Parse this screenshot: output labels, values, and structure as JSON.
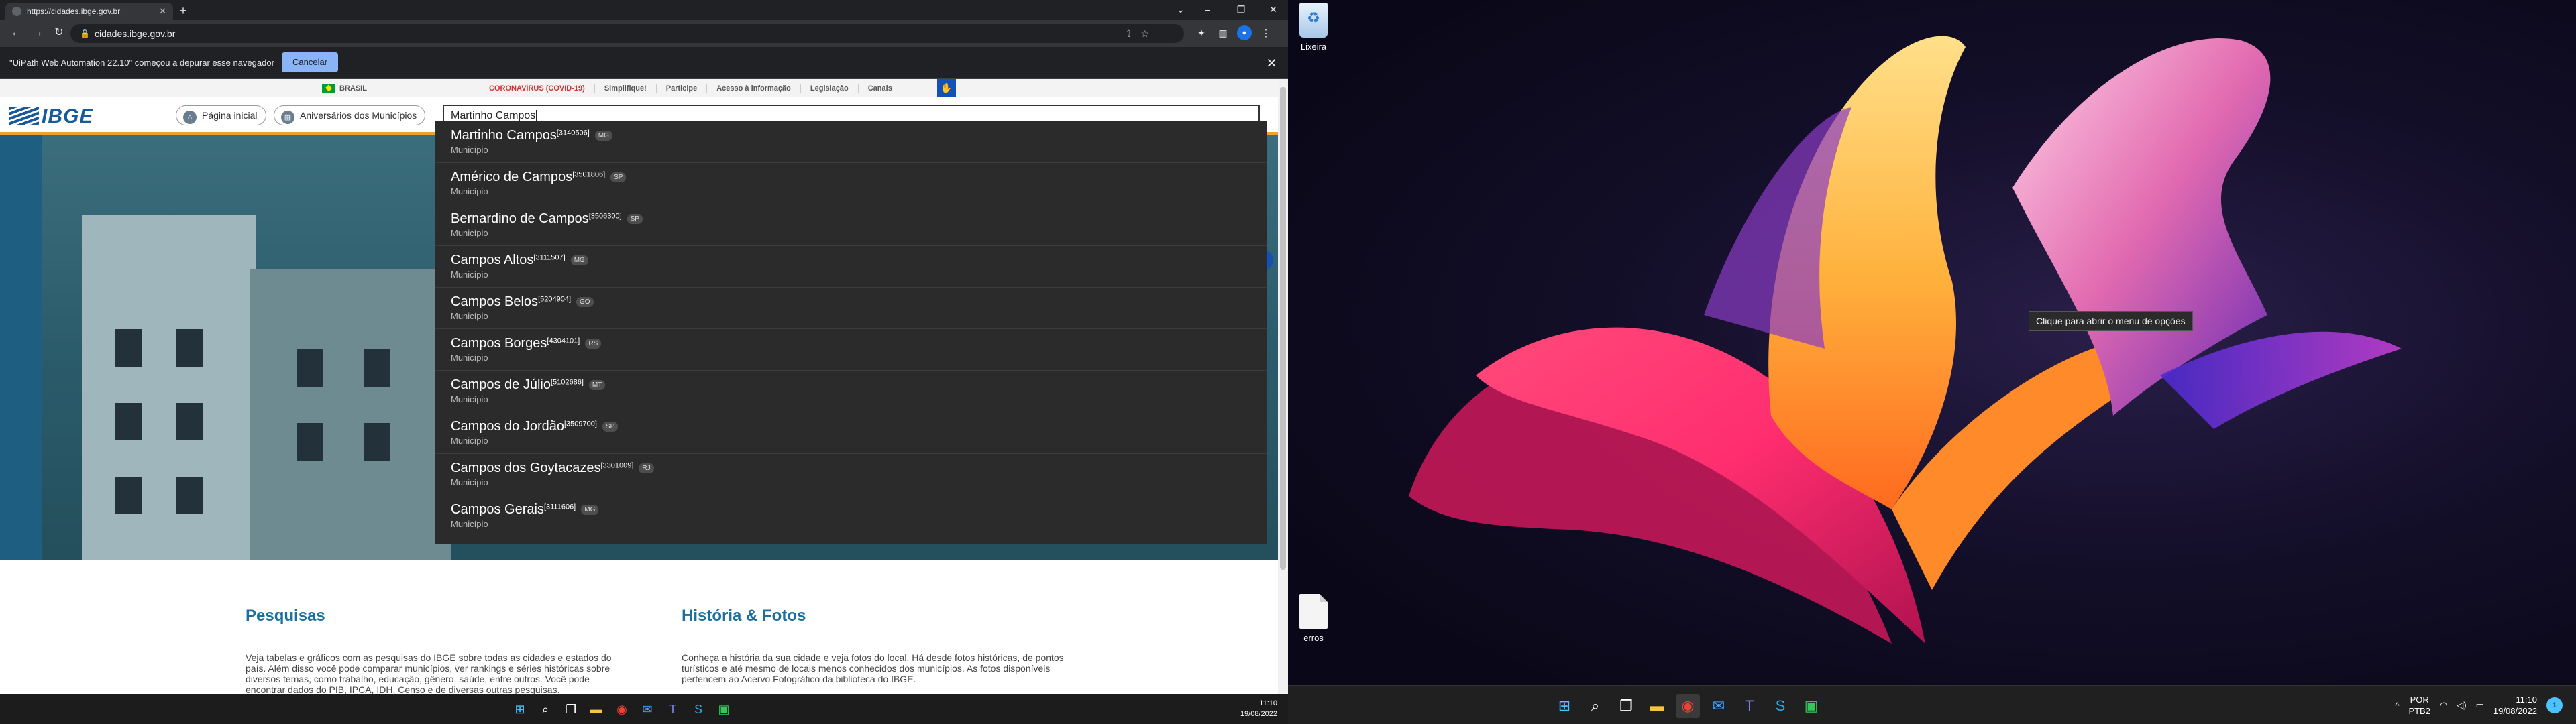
{
  "browser": {
    "tab_title": "https://cidades.ibge.gov.br",
    "url": "cidades.ibge.gov.br",
    "infobar_message": "\"UiPath Web Automation 22.10\" começou a depurar esse navegador",
    "infobar_cancel": "Cancelar"
  },
  "govbar": {
    "brasil": "BRASIL",
    "links": [
      "CORONAVÍRUS (COVID-19)",
      "Simplifique!",
      "Participe",
      "Acesso à informação",
      "Legislação",
      "Canais"
    ]
  },
  "header": {
    "logo": "IBGE",
    "home_button": "Página inicial",
    "anniversary_button": "Aniversários dos Municípios",
    "search_value": "Martinho Campos"
  },
  "dropdown": [
    {
      "name": "Martinho Campos",
      "code": "[3140506]",
      "uf": "MG",
      "type": "Município"
    },
    {
      "name": "Américo de Campos",
      "code": "[3501806]",
      "uf": "SP",
      "type": "Município"
    },
    {
      "name": "Bernardino de Campos",
      "code": "[3506300]",
      "uf": "SP",
      "type": "Município"
    },
    {
      "name": "Campos Altos",
      "code": "[3111507]",
      "uf": "MG",
      "type": "Município"
    },
    {
      "name": "Campos Belos",
      "code": "[5204904]",
      "uf": "GO",
      "type": "Município"
    },
    {
      "name": "Campos Borges",
      "code": "[4304101]",
      "uf": "RS",
      "type": "Município"
    },
    {
      "name": "Campos de Júlio",
      "code": "[5102686]",
      "uf": "MT",
      "type": "Município"
    },
    {
      "name": "Campos do Jordão",
      "code": "[3509700]",
      "uf": "SP",
      "type": "Município"
    },
    {
      "name": "Campos dos Goytacazes",
      "code": "[3301009]",
      "uf": "RJ",
      "type": "Município"
    },
    {
      "name": "Campos Gerais",
      "code": "[3111606]",
      "uf": "MG",
      "type": "Município"
    }
  ],
  "sections": {
    "pesquisas": {
      "title": "Pesquisas",
      "text": "Veja tabelas e gráficos com as pesquisas do IBGE sobre todas as cidades e estados do país. Além disso você pode comparar municípios, ver rankings e séries históricas sobre diversos temas, como trabalho, educação, gênero, saúde, entre outros. Você pode encontrar dados do PIB, IPCA, IDH, Censo e de diversas outras pesquisas."
    },
    "historia": {
      "title": "História & Fotos",
      "text": "Conheça a história da sua cidade e veja fotos do local. Há desde fotos históricas, de pontos turísticos e até mesmo de locais menos conhecidos dos municípios. As fotos disponíveis pertencem ao Acervo Fotográfico da biblioteca do IBGE."
    }
  },
  "taskbar_left": {
    "time": "11:10",
    "date": "19/08/2022"
  },
  "desktop": {
    "trash_label": "Lixeira",
    "file_label": "erros",
    "tooltip": "Clique para abrir o menu de opções"
  },
  "taskbar_right": {
    "lang": "POR",
    "layout": "PTB2",
    "time": "11:10",
    "date": "19/08/2022",
    "notifications": "1"
  },
  "colors": {
    "ibge_blue": "#1a5a9a",
    "ibge_orange": "#f0a030",
    "gov_blue": "#1351b4",
    "covid_red": "#d32f2f",
    "dropdown_bg": "#2b2b2b"
  }
}
